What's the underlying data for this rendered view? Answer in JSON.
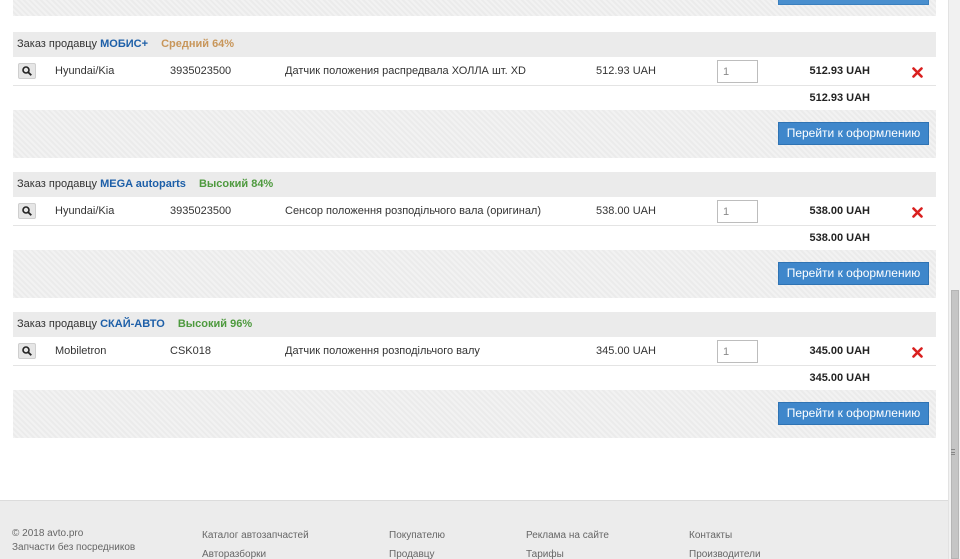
{
  "orders": [
    {
      "prefix": "Заказ продавцу",
      "seller": "МОБИС+",
      "rating": "Средний 64%",
      "item": {
        "brand": "Hyundai/Kia",
        "code": "3935023500",
        "description": "Датчик положения распредвала ХОЛЛА шт. XD",
        "price": "512.93 UAH",
        "quantity": "1",
        "total": "512.93 UAH"
      },
      "sum": "512.93 UAH",
      "checkout_label": "Перейти к оформлению"
    },
    {
      "prefix": "Заказ продавцу",
      "seller": "MEGA autoparts",
      "rating": "Высокий 84%",
      "item": {
        "brand": "Hyundai/Kia",
        "code": "3935023500",
        "description": "Сенсор положення розподільчого вала (оригинал)",
        "price": "538.00 UAH",
        "quantity": "1",
        "total": "538.00 UAH"
      },
      "sum": "538.00 UAH",
      "checkout_label": "Перейти к оформлению"
    },
    {
      "prefix": "Заказ продавцу",
      "seller": "СКАЙ-АВТО",
      "rating": "Высокий 96%",
      "item": {
        "brand": "Mobiletron",
        "code": "CSK018",
        "description": "Датчик положення розподільчого валу",
        "price": "345.00 UAH",
        "quantity": "1",
        "total": "345.00 UAH"
      },
      "sum": "345.00 UAH",
      "checkout_label": "Перейти к оформлению"
    }
  ],
  "footer": {
    "copyright": "© 2018 avto.pro",
    "tagline": "Запчасти без посредников",
    "links": [
      "Каталог автозапчастей",
      "Авторазборки",
      "Покупателю",
      "Продавцу",
      "Реклама на сайте",
      "Тарифы",
      "Контакты",
      "Производители"
    ]
  },
  "icons": {
    "search": "search-icon",
    "remove": "remove-icon"
  },
  "colors": {
    "seller_link": "#1d5fa8",
    "rating_mid": "#c8965a",
    "rating_high": "#4e9a3e",
    "checkout_button": "#3f87cb",
    "remove_icon": "#d9201f"
  }
}
